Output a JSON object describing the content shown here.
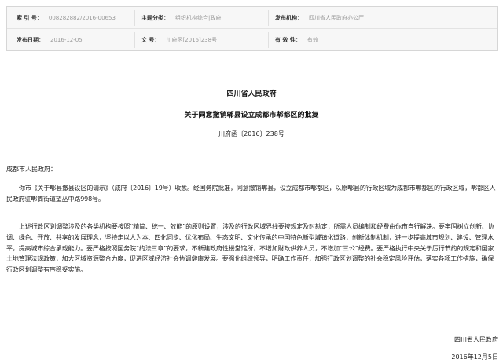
{
  "meta": {
    "index_label": "索 引 号：",
    "index_value": "008282882/2016-00653",
    "category_label": "主题分类：",
    "category_value": "组织机构综合|政府",
    "issuer_label": "发布机构：",
    "issuer_value": "四川省人民政府办公厅",
    "date_label": "发布日期：",
    "date_value": "2016-12-05",
    "docno_label": "文 号：",
    "docno_value": "川府函[2016]238号",
    "validity_label": "有 效 性：",
    "validity_value": "有效"
  },
  "document": {
    "issuer": "四川省人民政府",
    "title": "关于同意撤销郫县设立成都市郫都区的批复",
    "number": "川府函〔2016〕238号",
    "addressee": "成都市人民政府：",
    "paragraphs": [
      "你市《关于郫县撤县设区的请示》（成府〔2016〕19号）收悉。经国务院批准，同意撤销郫县，设立成都市郫都区，以原郫县的行政区域为成都市郫都区的行政区域，郫都区人民政府驻郫筒街道望丛中路998号。",
      "上述行政区划调整涉及的各类机构要按照“精简、统一、效能”的原则设置，涉及的行政区域界线要按规定及时勘定，所需人员编制和经费由你市自行解决。要牢固树立创新、协调、绿色、开放、共享的发展理念，坚持走以人为本、四化同步、优化布局、生态文明、文化传承的中国特色新型城镇化道路，创新体制机制，进一步提高城市规划、建设、管理水平，提高城市综合承载能力。要严格按照国务院“约法三章”的要求，不新建政府性楼堂馆所，不增加财政供养人员，不增加“三公”经费。要严格执行中央关于厉行节约的规定和国家土地管理法规政策，加大区域资源整合力度，促进区域经济社会协调健康发展。要强化组织领导，明确工作责任，加强行政区划调整的社会稳定风险评估，落实各项工作措施，确保行政区划调整有序稳妥实施。"
    ],
    "signer": "四川省人民政府",
    "date": "2016年12月5日"
  }
}
